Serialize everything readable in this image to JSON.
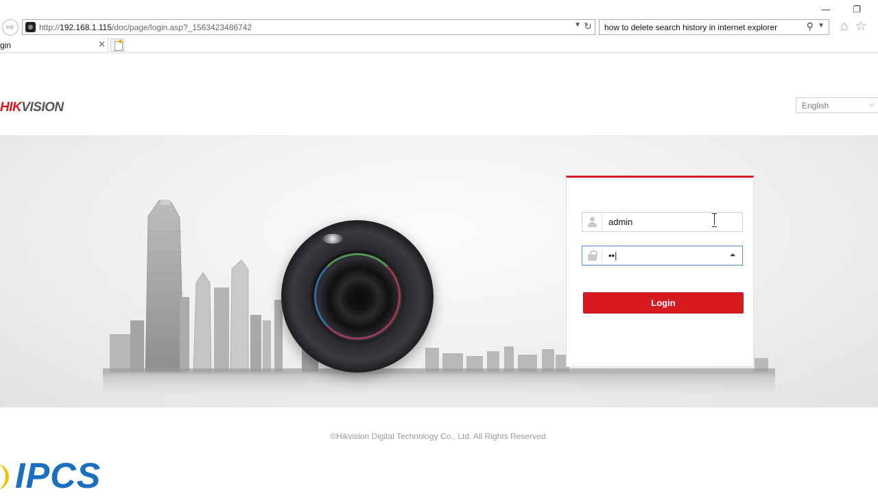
{
  "browser": {
    "window_controls": {
      "minimize": "—",
      "restore": "❐"
    },
    "back_glyph": "⇨",
    "url_prefix": "http://",
    "url_host": "192.168.1.115",
    "url_path": "/doc/page/login.asp?_1563423486742",
    "search_query": "how to delete search history in internet explorer",
    "tab_title": "gin",
    "tab_close": "✕",
    "toolbar_icons": [
      "home-icon",
      "star-icon"
    ],
    "home_glyph": "⌂",
    "star_glyph": "☆"
  },
  "page": {
    "logo": {
      "red_part": "HIK",
      "gray_part": "VISION"
    },
    "language_select": {
      "value": "English",
      "chevron": "⌵"
    },
    "login": {
      "username": "admin",
      "password_mask": "••|",
      "button_label": "Login",
      "eye_glyph": "⏶"
    },
    "copyright": "©Hikvision Digital Technology Co., Ltd. All Rights Reserved."
  },
  "watermark": {
    "text": "IPCS"
  },
  "colors": {
    "brand_red": "#d71920",
    "watermark_blue": "#1a6fc0",
    "focus_blue": "#4d90d6"
  }
}
